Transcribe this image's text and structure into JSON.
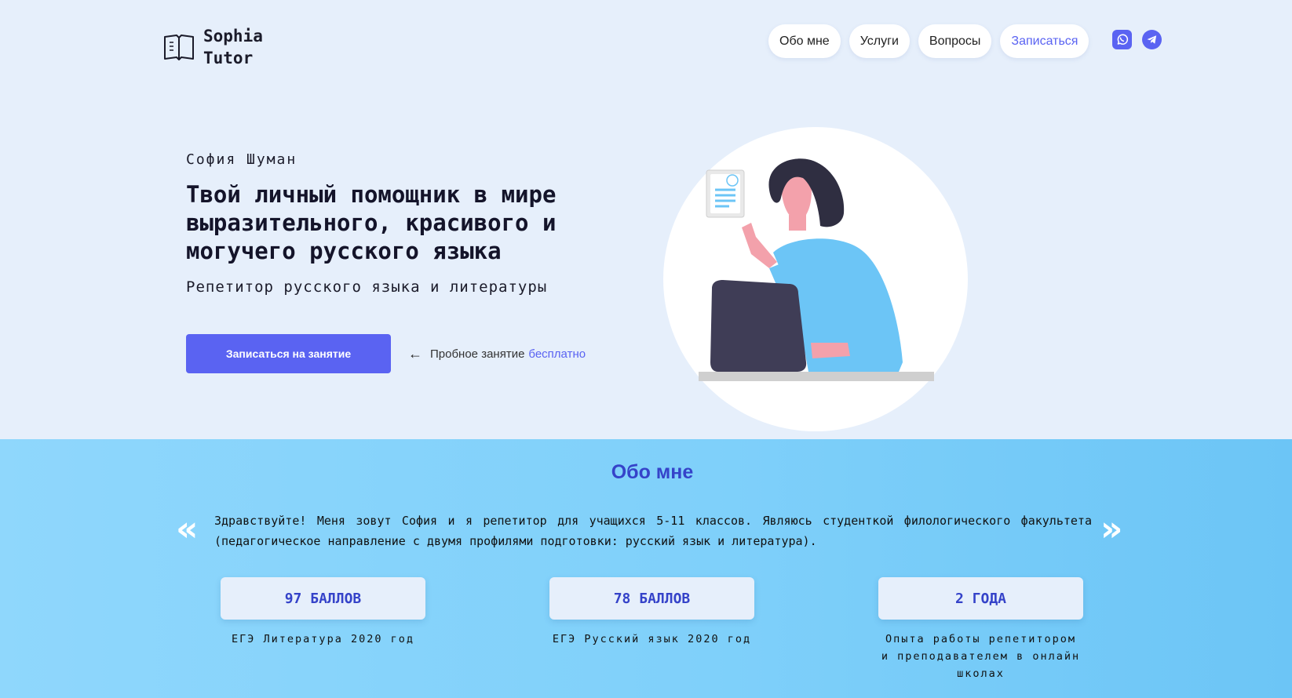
{
  "header": {
    "logo_line1": "Sophia",
    "logo_line2": "Tutor",
    "logo_icon": "open-book-icon",
    "nav": [
      "Обо мне",
      "Услуги",
      "Вопросы",
      "Записаться"
    ],
    "social": [
      "whatsapp-icon",
      "telegram-icon"
    ]
  },
  "hero": {
    "name": "София Шуман",
    "title": "Твой личный помощник в мире выразительного, красивого и могучего русского языка",
    "subtitle": "Репетитор русского языка и литературы",
    "cta_label": "Записаться на занятие",
    "trial_text": "Пробное занятие",
    "trial_free": "бесплатно"
  },
  "about": {
    "title": "Обо мне",
    "text": "Здравствуйте! Меня зовут София и я репетитор для учащихся 5-11 классов. Являюсь студенткой филологического факультета (педагогическое направление с двумя профилями подготовки: русский язык и литература).",
    "prev": "«",
    "next": "»",
    "stats": [
      {
        "value": "97 БАЛЛОВ",
        "label": "ЕГЭ Литература 2020 год"
      },
      {
        "value": "78 БАЛЛОВ",
        "label": "ЕГЭ Русский язык 2020 год"
      },
      {
        "value": "2 ГОДА",
        "label": "Опыта работы репетитором и преподавателем в онлайн школах"
      }
    ]
  },
  "colors": {
    "accent": "#5a63f2",
    "heading_blue": "#3543c9",
    "hero_bg": "#e6effb",
    "about_bg": "#7fd0fa"
  }
}
